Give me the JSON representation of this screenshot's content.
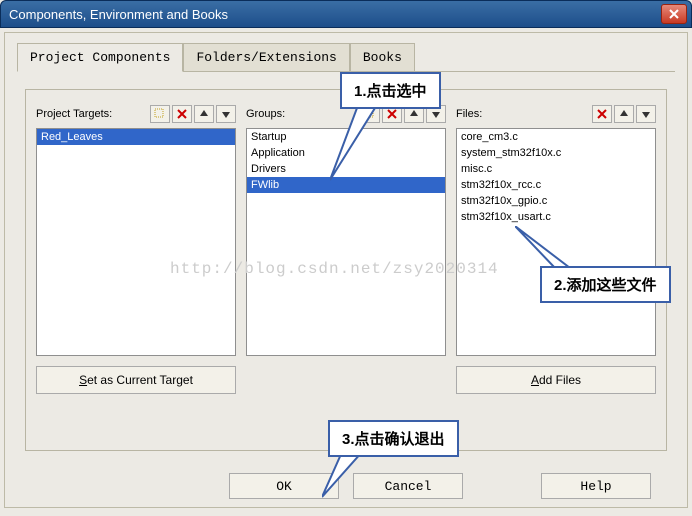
{
  "title": "Components, Environment and Books",
  "tabs": {
    "t0": "Project Components",
    "t1": "Folders/Extensions",
    "t2": "Books"
  },
  "cols": {
    "targets": {
      "label": "Project Targets:",
      "items": [
        "Red_Leaves"
      ],
      "btn": "Set as Current Target"
    },
    "groups": {
      "label": "Groups:",
      "items": [
        "Startup",
        "Application",
        "Drivers",
        "FWlib"
      ]
    },
    "files": {
      "label": "Files:",
      "items": [
        "core_cm3.c",
        "system_stm32f10x.c",
        "misc.c",
        "stm32f10x_rcc.c",
        "stm32f10x_gpio.c",
        "stm32f10x_usart.c"
      ],
      "btn": "Add Files"
    }
  },
  "buttons": {
    "ok": "OK",
    "cancel": "Cancel",
    "help": "Help"
  },
  "callouts": {
    "c1": "1.点击选中",
    "c2": "2.添加这些文件",
    "c3": "3.点击确认退出"
  },
  "watermark": "http://blog.csdn.net/zsy2020314"
}
